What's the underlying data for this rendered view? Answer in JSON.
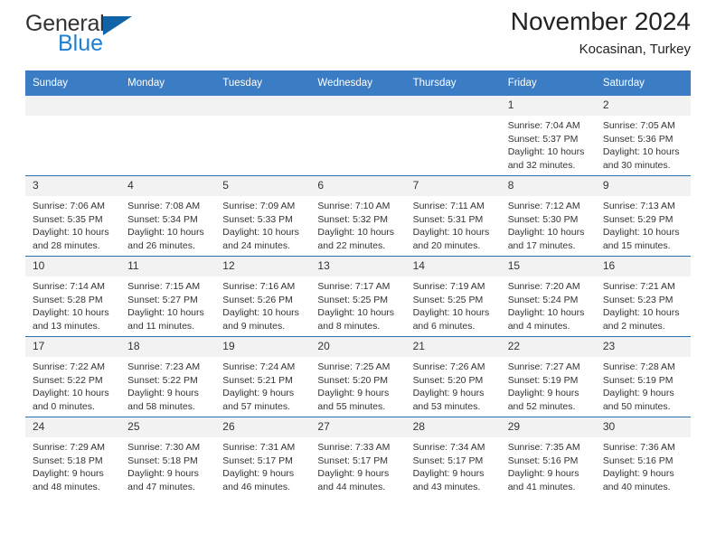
{
  "brand": {
    "name_part1": "General",
    "name_part2": "Blue",
    "triangle_color": "#1163a8",
    "blue_color": "#1f7fd0"
  },
  "header": {
    "title": "November 2024",
    "subtitle": "Kocasinan, Turkey"
  },
  "theme": {
    "header_bg": "#3b7dc4",
    "header_text": "#ffffff",
    "daynum_bg": "#f2f2f2",
    "row_divider": "#2f6fae",
    "body_text": "#333333"
  },
  "weekdays": [
    "Sunday",
    "Monday",
    "Tuesday",
    "Wednesday",
    "Thursday",
    "Friday",
    "Saturday"
  ],
  "weeks": [
    [
      {
        "day": "",
        "empty": true
      },
      {
        "day": "",
        "empty": true
      },
      {
        "day": "",
        "empty": true
      },
      {
        "day": "",
        "empty": true
      },
      {
        "day": "",
        "empty": true
      },
      {
        "day": "1",
        "sunrise": "Sunrise: 7:04 AM",
        "sunset": "Sunset: 5:37 PM",
        "daylight": "Daylight: 10 hours and 32 minutes."
      },
      {
        "day": "2",
        "sunrise": "Sunrise: 7:05 AM",
        "sunset": "Sunset: 5:36 PM",
        "daylight": "Daylight: 10 hours and 30 minutes."
      }
    ],
    [
      {
        "day": "3",
        "sunrise": "Sunrise: 7:06 AM",
        "sunset": "Sunset: 5:35 PM",
        "daylight": "Daylight: 10 hours and 28 minutes."
      },
      {
        "day": "4",
        "sunrise": "Sunrise: 7:08 AM",
        "sunset": "Sunset: 5:34 PM",
        "daylight": "Daylight: 10 hours and 26 minutes."
      },
      {
        "day": "5",
        "sunrise": "Sunrise: 7:09 AM",
        "sunset": "Sunset: 5:33 PM",
        "daylight": "Daylight: 10 hours and 24 minutes."
      },
      {
        "day": "6",
        "sunrise": "Sunrise: 7:10 AM",
        "sunset": "Sunset: 5:32 PM",
        "daylight": "Daylight: 10 hours and 22 minutes."
      },
      {
        "day": "7",
        "sunrise": "Sunrise: 7:11 AM",
        "sunset": "Sunset: 5:31 PM",
        "daylight": "Daylight: 10 hours and 20 minutes."
      },
      {
        "day": "8",
        "sunrise": "Sunrise: 7:12 AM",
        "sunset": "Sunset: 5:30 PM",
        "daylight": "Daylight: 10 hours and 17 minutes."
      },
      {
        "day": "9",
        "sunrise": "Sunrise: 7:13 AM",
        "sunset": "Sunset: 5:29 PM",
        "daylight": "Daylight: 10 hours and 15 minutes."
      }
    ],
    [
      {
        "day": "10",
        "sunrise": "Sunrise: 7:14 AM",
        "sunset": "Sunset: 5:28 PM",
        "daylight": "Daylight: 10 hours and 13 minutes."
      },
      {
        "day": "11",
        "sunrise": "Sunrise: 7:15 AM",
        "sunset": "Sunset: 5:27 PM",
        "daylight": "Daylight: 10 hours and 11 minutes."
      },
      {
        "day": "12",
        "sunrise": "Sunrise: 7:16 AM",
        "sunset": "Sunset: 5:26 PM",
        "daylight": "Daylight: 10 hours and 9 minutes."
      },
      {
        "day": "13",
        "sunrise": "Sunrise: 7:17 AM",
        "sunset": "Sunset: 5:25 PM",
        "daylight": "Daylight: 10 hours and 8 minutes."
      },
      {
        "day": "14",
        "sunrise": "Sunrise: 7:19 AM",
        "sunset": "Sunset: 5:25 PM",
        "daylight": "Daylight: 10 hours and 6 minutes."
      },
      {
        "day": "15",
        "sunrise": "Sunrise: 7:20 AM",
        "sunset": "Sunset: 5:24 PM",
        "daylight": "Daylight: 10 hours and 4 minutes."
      },
      {
        "day": "16",
        "sunrise": "Sunrise: 7:21 AM",
        "sunset": "Sunset: 5:23 PM",
        "daylight": "Daylight: 10 hours and 2 minutes."
      }
    ],
    [
      {
        "day": "17",
        "sunrise": "Sunrise: 7:22 AM",
        "sunset": "Sunset: 5:22 PM",
        "daylight": "Daylight: 10 hours and 0 minutes."
      },
      {
        "day": "18",
        "sunrise": "Sunrise: 7:23 AM",
        "sunset": "Sunset: 5:22 PM",
        "daylight": "Daylight: 9 hours and 58 minutes."
      },
      {
        "day": "19",
        "sunrise": "Sunrise: 7:24 AM",
        "sunset": "Sunset: 5:21 PM",
        "daylight": "Daylight: 9 hours and 57 minutes."
      },
      {
        "day": "20",
        "sunrise": "Sunrise: 7:25 AM",
        "sunset": "Sunset: 5:20 PM",
        "daylight": "Daylight: 9 hours and 55 minutes."
      },
      {
        "day": "21",
        "sunrise": "Sunrise: 7:26 AM",
        "sunset": "Sunset: 5:20 PM",
        "daylight": "Daylight: 9 hours and 53 minutes."
      },
      {
        "day": "22",
        "sunrise": "Sunrise: 7:27 AM",
        "sunset": "Sunset: 5:19 PM",
        "daylight": "Daylight: 9 hours and 52 minutes."
      },
      {
        "day": "23",
        "sunrise": "Sunrise: 7:28 AM",
        "sunset": "Sunset: 5:19 PM",
        "daylight": "Daylight: 9 hours and 50 minutes."
      }
    ],
    [
      {
        "day": "24",
        "sunrise": "Sunrise: 7:29 AM",
        "sunset": "Sunset: 5:18 PM",
        "daylight": "Daylight: 9 hours and 48 minutes."
      },
      {
        "day": "25",
        "sunrise": "Sunrise: 7:30 AM",
        "sunset": "Sunset: 5:18 PM",
        "daylight": "Daylight: 9 hours and 47 minutes."
      },
      {
        "day": "26",
        "sunrise": "Sunrise: 7:31 AM",
        "sunset": "Sunset: 5:17 PM",
        "daylight": "Daylight: 9 hours and 46 minutes."
      },
      {
        "day": "27",
        "sunrise": "Sunrise: 7:33 AM",
        "sunset": "Sunset: 5:17 PM",
        "daylight": "Daylight: 9 hours and 44 minutes."
      },
      {
        "day": "28",
        "sunrise": "Sunrise: 7:34 AM",
        "sunset": "Sunset: 5:17 PM",
        "daylight": "Daylight: 9 hours and 43 minutes."
      },
      {
        "day": "29",
        "sunrise": "Sunrise: 7:35 AM",
        "sunset": "Sunset: 5:16 PM",
        "daylight": "Daylight: 9 hours and 41 minutes."
      },
      {
        "day": "30",
        "sunrise": "Sunrise: 7:36 AM",
        "sunset": "Sunset: 5:16 PM",
        "daylight": "Daylight: 9 hours and 40 minutes."
      }
    ]
  ]
}
